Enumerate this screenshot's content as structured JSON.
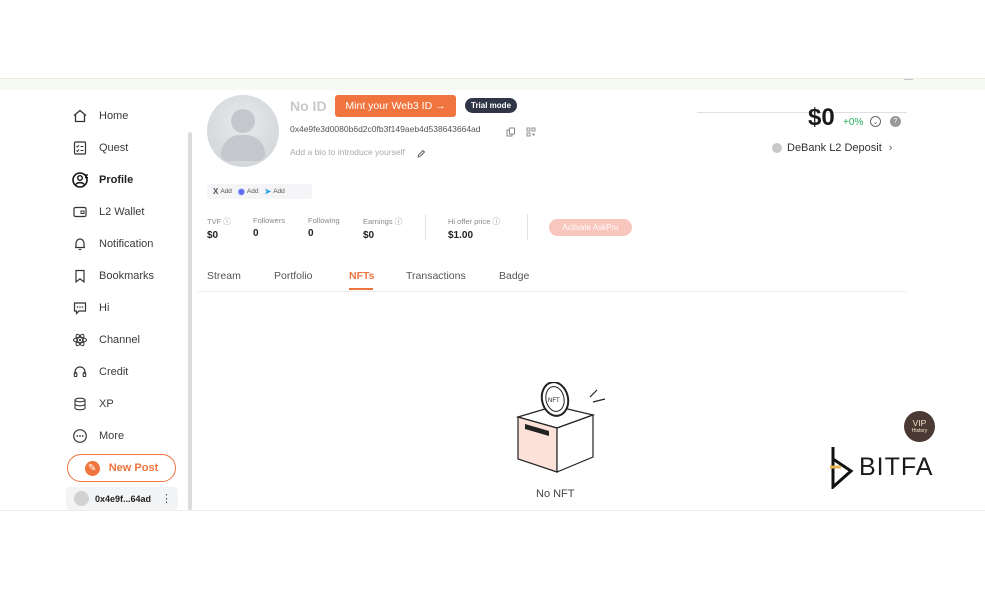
{
  "sidebar": {
    "items": [
      {
        "label": "Home",
        "icon": "home-icon"
      },
      {
        "label": "Quest",
        "icon": "quest-icon"
      },
      {
        "label": "Profile",
        "icon": "profile-icon",
        "active": true
      },
      {
        "label": "L2 Wallet",
        "icon": "wallet-icon"
      },
      {
        "label": "Notification",
        "icon": "bell-icon"
      },
      {
        "label": "Bookmarks",
        "icon": "bookmark-icon"
      },
      {
        "label": "Hi",
        "icon": "chat-icon"
      },
      {
        "label": "Channel",
        "icon": "atom-icon"
      },
      {
        "label": "Credit",
        "icon": "headset-icon"
      },
      {
        "label": "XP",
        "icon": "stack-icon"
      },
      {
        "label": "More",
        "icon": "more-icon"
      }
    ],
    "new_post": "New Post",
    "account": {
      "address": "0x4e9f...64ad",
      "menu": "⋮"
    }
  },
  "profile": {
    "name": "No ID",
    "mint_button": "Mint your Web3 ID →",
    "trial_badge": "Trial mode",
    "wallet_address": "0x4e9fe3d0080b6d2c0fb3f149aeb4d538643664ad",
    "bio_placeholder": "Add a bio to introduce yourself",
    "social": [
      {
        "glyph": "X",
        "label": "Add"
      },
      {
        "glyph": "◉",
        "label": "Add"
      },
      {
        "glyph": "➤",
        "label": "Add"
      }
    ]
  },
  "stats": [
    {
      "key": "TVF ⓘ",
      "value": "$0"
    },
    {
      "key": "Followers",
      "value": "0"
    },
    {
      "key": "Following",
      "value": "0"
    },
    {
      "key": "Earnings ⓘ",
      "value": "$0"
    },
    {
      "key": "Hi offer price ⓘ",
      "value": "$1.00"
    }
  ],
  "askpro_button": "Activate AskPro",
  "balance": {
    "amount": "$0",
    "change": "+0%",
    "deposit_label": "DeBank L2 Deposit",
    "arrow": "›"
  },
  "tabs": [
    "Stream",
    "Portfolio",
    "NFTs",
    "Transactions",
    "Badge"
  ],
  "active_tab": "NFTs",
  "empty_state": {
    "text": "No NFT",
    "art_text": "NFT"
  },
  "vip": {
    "line1": "VIP",
    "line2": "History"
  },
  "watermark": "BITFA",
  "colors": {
    "accent": "#f0743e",
    "positive": "#27ae60",
    "trial_bg": "#2f3546"
  }
}
